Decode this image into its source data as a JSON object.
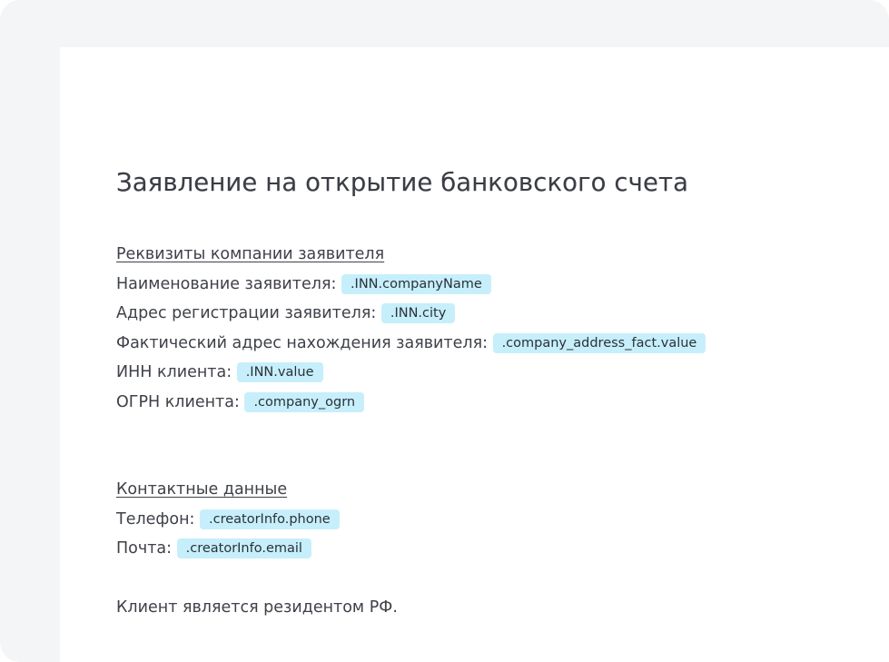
{
  "document": {
    "title": "Заявление на открытие банковского счета",
    "company_section": {
      "heading": "Реквизиты компании заявителя",
      "rows": [
        {
          "label": "Наименование заявителя:",
          "tag": ".INN.companyName"
        },
        {
          "label": "Адрес регистрации заявителя:",
          "tag": ".INN.city"
        },
        {
          "label": "Фактический адрес нахождения заявителя:",
          "tag": ".company_address_fact.value"
        },
        {
          "label": "ИНН клиента:",
          "tag": ".INN.value"
        },
        {
          "label": "ОГРН клиента:",
          "tag": ".company_ogrn"
        }
      ]
    },
    "contact_section": {
      "heading": "Контактные данные",
      "rows": [
        {
          "label": "Телефон:",
          "tag": ".creatorInfo.phone"
        },
        {
          "label": "Почта:",
          "tag": ".creatorInfo.email"
        }
      ]
    },
    "resident_text": "Клиент является резидентом РФ."
  },
  "colors": {
    "tag_background": "#c6effb",
    "text": "#3e4148",
    "frame_background": "#f4f5f7"
  }
}
